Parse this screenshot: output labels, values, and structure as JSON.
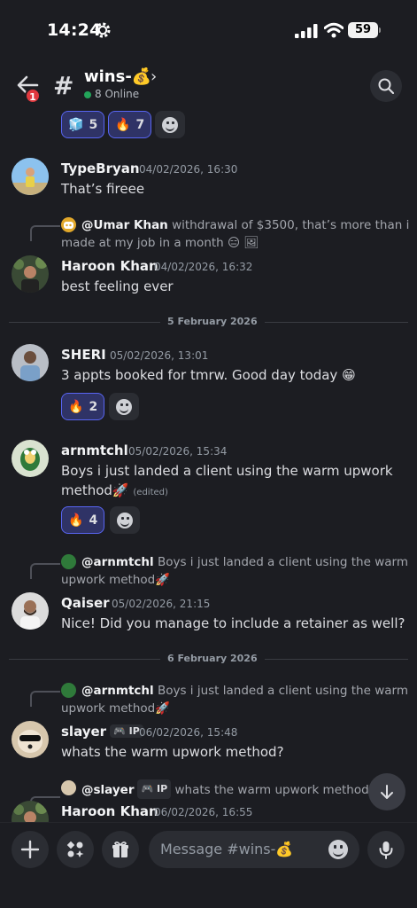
{
  "status_bar": {
    "time": "14:24",
    "battery": "59"
  },
  "header": {
    "back_badge": "1",
    "hash": "#",
    "channel_name": "wins-💰",
    "chevron": "›",
    "online": "8 Online"
  },
  "top_reactions": [
    {
      "emoji": "🧊",
      "count": "5"
    },
    {
      "emoji": "🔥",
      "count": "7"
    }
  ],
  "messages": [
    {
      "author": "TypeBryan",
      "time": "04/02/2026, 16:30",
      "text": "That’s fireee"
    },
    {
      "reply": {
        "name": "@Umar Khan",
        "text": "withdrawal of $3500, that’s more than i",
        "text2": "made at my job in a month 😑 🖼"
      },
      "author": "Haroon Khan",
      "time": "04/02/2026, 16:32",
      "text": "best feeling ever"
    },
    {
      "author": "SHERI",
      "time": "05/02/2026, 13:01",
      "text": "3 appts booked for tmrw. Good day today 😁",
      "reaction": {
        "emoji": "🔥",
        "count": "2"
      }
    },
    {
      "author": "arnmtchl",
      "time": "05/02/2026, 15:34",
      "text": "Boys i just landed a client using the warm upwork",
      "text2": "method🚀",
      "edited": "(edited)",
      "reaction": {
        "emoji": "🔥",
        "count": "4"
      }
    },
    {
      "reply": {
        "name": "@arnmtchl",
        "text": "Boys i just landed a client using the warm",
        "text2": "upwork method🚀"
      },
      "author": "Qaiser",
      "time": "05/02/2026, 21:15",
      "text": "Nice! Did you manage to include a retainer as well?"
    },
    {
      "reply": {
        "name": "@arnmtchl",
        "text": "Boys i just landed a client using the warm",
        "text2": "upwork method🚀"
      },
      "author": "slayer",
      "tag": "IP",
      "time": "06/02/2026, 15:48",
      "text": "whats the warm upwork method?"
    },
    {
      "reply": {
        "name": "@slayer",
        "tag": "IP",
        "text": "whats the warm upwork method?"
      },
      "author": "Haroon Khan",
      "time": "06/02/2026, 16:55"
    }
  ],
  "dividers": [
    "5 February 2026",
    "6 February 2026"
  ],
  "composer": {
    "placeholder": "Message #wins-💰"
  },
  "colors": {
    "background": "#1c1d22",
    "accent": "#5865f2",
    "online": "#23a55a",
    "badge": "#e0383e"
  }
}
